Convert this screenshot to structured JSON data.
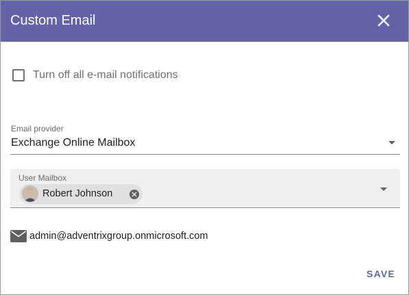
{
  "dialog": {
    "title": "Custom Email",
    "close_icon": "close-icon",
    "header_color": "#6264a7"
  },
  "notifications": {
    "checkbox_label": "Turn off all e-mail notifications",
    "checked": false
  },
  "provider": {
    "label": "Email provider",
    "value": "Exchange Online Mailbox"
  },
  "mailbox": {
    "label": "User Mailbox",
    "chip_name": "Robert Johnson",
    "chip_icons": [
      "avatar",
      "remove-icon"
    ]
  },
  "email": {
    "icon": "envelope-icon",
    "address": "admin@adventrixgroup.onmicrosoft.com"
  },
  "actions": {
    "save_label": "SAVE"
  }
}
